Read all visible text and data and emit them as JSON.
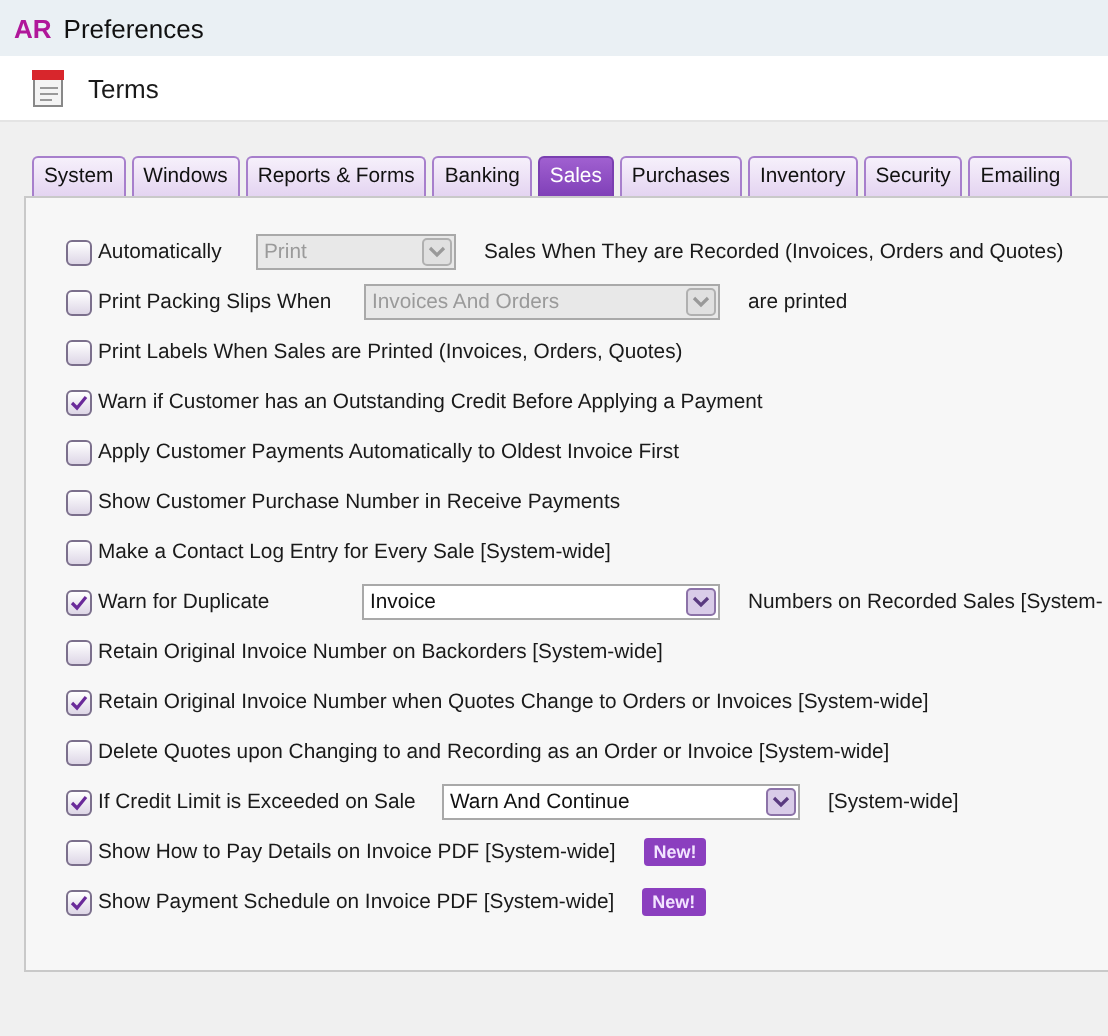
{
  "window": {
    "logo": "AR",
    "title": "Preferences"
  },
  "toolbar": {
    "label": "Terms"
  },
  "tabs": [
    {
      "label": "System",
      "selected": false
    },
    {
      "label": "Windows",
      "selected": false
    },
    {
      "label": "Reports & Forms",
      "selected": false
    },
    {
      "label": "Banking",
      "selected": false
    },
    {
      "label": "Sales",
      "selected": true
    },
    {
      "label": "Purchases",
      "selected": false
    },
    {
      "label": "Inventory",
      "selected": false
    },
    {
      "label": "Security",
      "selected": false
    },
    {
      "label": "Emailing",
      "selected": false
    }
  ],
  "options": [
    {
      "kind": "select",
      "label": "Automatically",
      "checked": false,
      "select": {
        "value": "Print",
        "disabled": true
      },
      "suffix": "Sales When They are Recorded (Invoices, Orders and Quotes)"
    },
    {
      "kind": "select",
      "label": "Print Packing Slips When",
      "checked": false,
      "select": {
        "value": "Invoices And Orders",
        "disabled": true
      },
      "suffix": "are printed"
    },
    {
      "kind": "plain",
      "label": "Print Labels When Sales are Printed (Invoices, Orders, Quotes)",
      "checked": false
    },
    {
      "kind": "plain",
      "label": "Warn if Customer has an Outstanding Credit Before Applying a Payment",
      "checked": true
    },
    {
      "kind": "plain",
      "label": "Apply Customer Payments Automatically to Oldest Invoice First",
      "checked": false
    },
    {
      "kind": "plain",
      "label": "Show Customer Purchase Number in Receive Payments",
      "checked": false
    },
    {
      "kind": "plain",
      "label": "Make a Contact Log Entry for Every Sale [System-wide]",
      "checked": false
    },
    {
      "kind": "select",
      "label": "Warn for Duplicate",
      "checked": true,
      "select": {
        "value": "Invoice",
        "disabled": false
      },
      "suffix": "Numbers on Recorded Sales [System-"
    },
    {
      "kind": "plain",
      "label": "Retain Original Invoice Number on Backorders [System-wide]",
      "checked": false
    },
    {
      "kind": "plain",
      "label": "Retain Original Invoice Number when Quotes Change to Orders or Invoices [System-wide]",
      "checked": true
    },
    {
      "kind": "plain",
      "label": "Delete Quotes upon Changing to and Recording as an Order or Invoice [System-wide]",
      "checked": false
    },
    {
      "kind": "select",
      "label": "If Credit Limit is Exceeded on Sale",
      "checked": true,
      "select": {
        "value": "Warn And Continue",
        "disabled": false
      },
      "suffix": "[System-wide]"
    },
    {
      "kind": "badge",
      "label": "Show How to Pay Details on Invoice PDF [System-wide]",
      "checked": false,
      "badge": "New!"
    },
    {
      "kind": "badge",
      "label": "Show Payment Schedule on Invoice PDF [System-wide]",
      "checked": true,
      "badge": "New!"
    }
  ]
}
